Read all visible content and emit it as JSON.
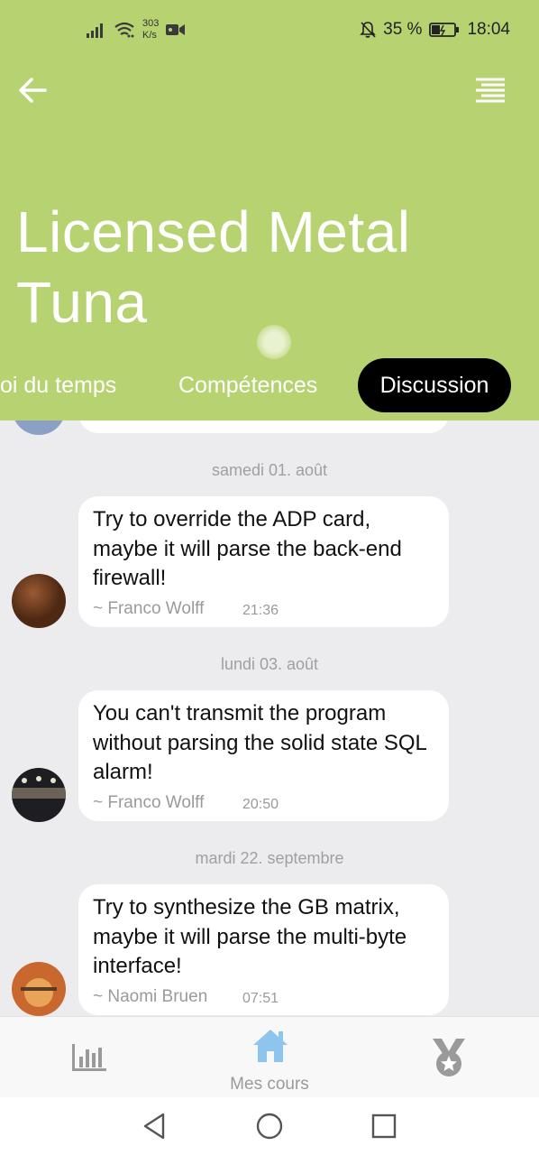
{
  "status_bar": {
    "net_speed_value": "303",
    "net_speed_unit": "K/s",
    "battery": "35 %",
    "time": "18:04"
  },
  "header": {
    "title": "Licensed Metal Tuna",
    "tabs": [
      {
        "label": "oi du temps",
        "active": false
      },
      {
        "label": "Compétences",
        "active": false
      },
      {
        "label": "Discussion",
        "active": true
      }
    ]
  },
  "chat": {
    "messages": [
      {
        "date": "samedi 01. août",
        "text": "Try to override the ADP card, maybe it will parse the back-end firewall!",
        "author": "~ Franco Wolff",
        "time": "21:36"
      },
      {
        "date": "lundi 03. août",
        "text": "You can't transmit the program without parsing the solid state SQL alarm!",
        "author": "~ Franco Wolff",
        "time": "20:50"
      },
      {
        "date": "mardi 22. septembre",
        "text": "Try to synthesize the GB matrix, maybe it will parse the multi-byte interface!",
        "author": "~ Naomi Bruen",
        "time": "07:51"
      }
    ]
  },
  "bottom_nav": {
    "items": [
      {
        "icon": "chart-icon",
        "label": ""
      },
      {
        "icon": "home-icon",
        "label": "Mes cours"
      },
      {
        "icon": "medal-icon",
        "label": ""
      }
    ],
    "active_color": "#8ec5ef",
    "inactive_color": "#9a9a9a"
  },
  "theme": {
    "header_color": "#b7d371",
    "active_tab_color": "#000000"
  }
}
